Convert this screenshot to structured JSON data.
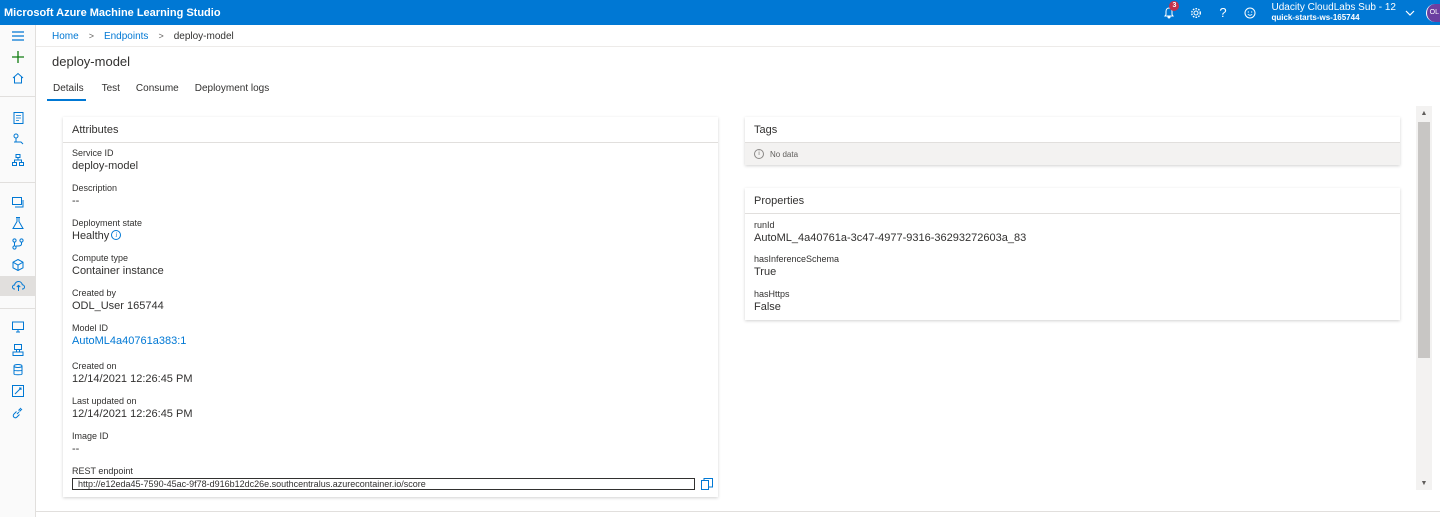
{
  "app": {
    "title": "Microsoft Azure Machine Learning Studio",
    "accent_color": "#0078d4"
  },
  "header": {
    "notification_count": "3",
    "account_name": "Udacity CloudLabs Sub - 12",
    "workspace": "quick-starts-ws-165744",
    "avatar_initials": "OL",
    "icons": [
      "bell-icon",
      "gear-icon",
      "help-icon",
      "smiley-icon",
      "chevron-down-icon"
    ]
  },
  "breadcrumb": {
    "home": "Home",
    "endpoints": "Endpoints",
    "current": "deploy-model"
  },
  "page": {
    "title": "deploy-model"
  },
  "tabs": [
    {
      "label": "Details",
      "active": true
    },
    {
      "label": "Test",
      "active": false
    },
    {
      "label": "Consume",
      "active": false
    },
    {
      "label": "Deployment logs",
      "active": false
    }
  ],
  "attributes": {
    "title": "Attributes",
    "service_id_label": "Service ID",
    "service_id": "deploy-model",
    "description_label": "Description",
    "description": "--",
    "deployment_state_label": "Deployment state",
    "deployment_state": "Healthy",
    "compute_type_label": "Compute type",
    "compute_type": "Container instance",
    "created_by_label": "Created by",
    "created_by": "ODL_User 165744",
    "model_id_label": "Model ID",
    "model_id": "AutoML4a40761a383:1",
    "created_on_label": "Created on",
    "created_on": "12/14/2021 12:26:45 PM",
    "last_updated_label": "Last updated on",
    "last_updated": "12/14/2021 12:26:45 PM",
    "image_id_label": "Image ID",
    "image_id": "--",
    "rest_endpoint_label": "REST endpoint",
    "rest_endpoint": "http://e12eda45-7590-45ac-9f78-d916b12dc26e.southcentralus.azurecontainer.io/score"
  },
  "tags": {
    "title": "Tags",
    "empty_text": "No data"
  },
  "properties": {
    "title": "Properties",
    "run_id_label": "runId",
    "run_id": "AutoML_4a40761a-3c47-4977-9316-36293272603a_83",
    "has_inference_schema_label": "hasInferenceSchema",
    "has_inference_schema": "True",
    "has_https_label": "hasHttps",
    "has_https": "False"
  }
}
